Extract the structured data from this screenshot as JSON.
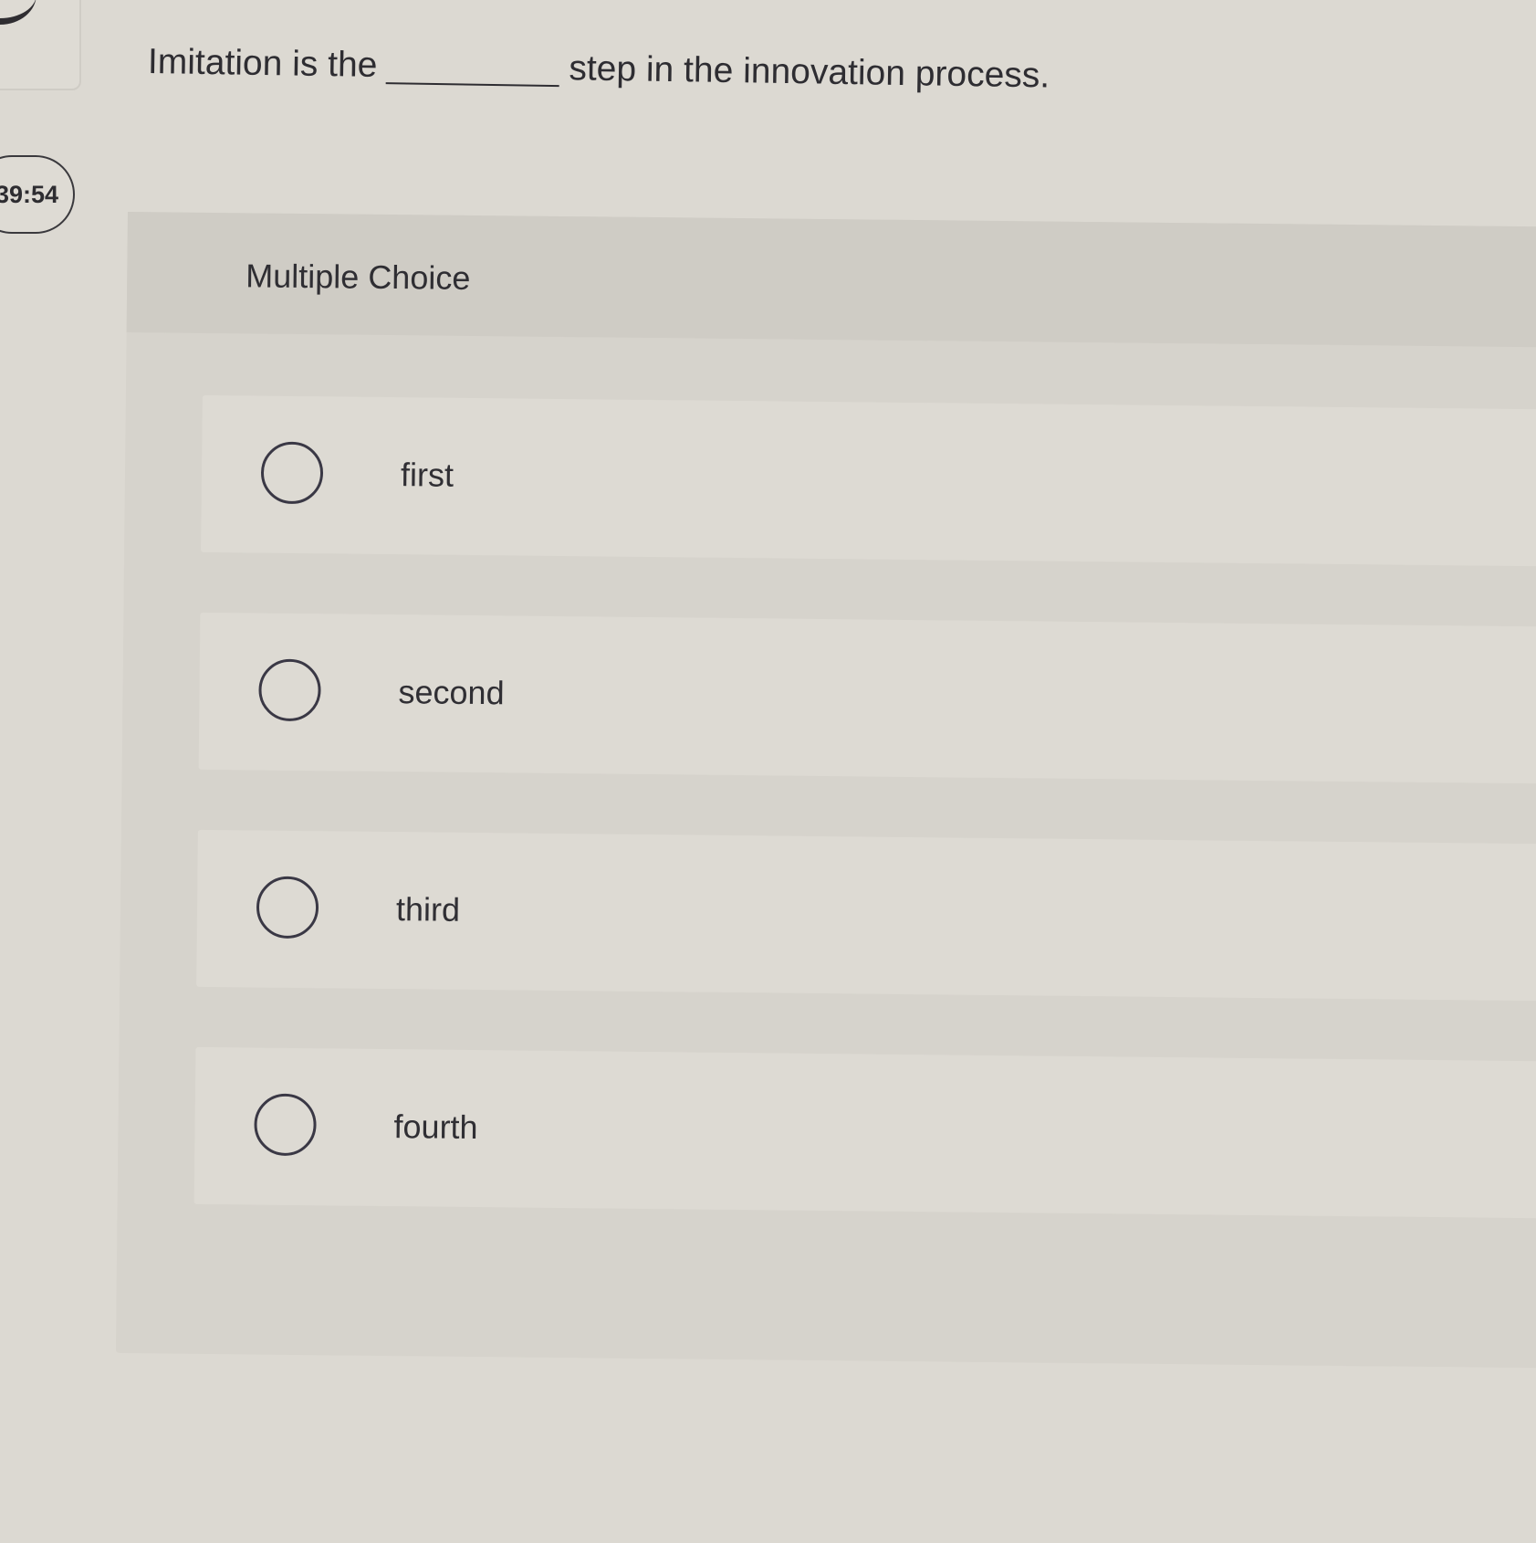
{
  "timer": {
    "text": "39:54"
  },
  "question": {
    "before_blank": "Imitation is the",
    "after_blank": "step in the innovation process."
  },
  "panel": {
    "title": "Multiple Choice"
  },
  "options": [
    {
      "label": "first",
      "selected": false
    },
    {
      "label": "second",
      "selected": false
    },
    {
      "label": "third",
      "selected": false
    },
    {
      "label": "fourth",
      "selected": false
    }
  ]
}
